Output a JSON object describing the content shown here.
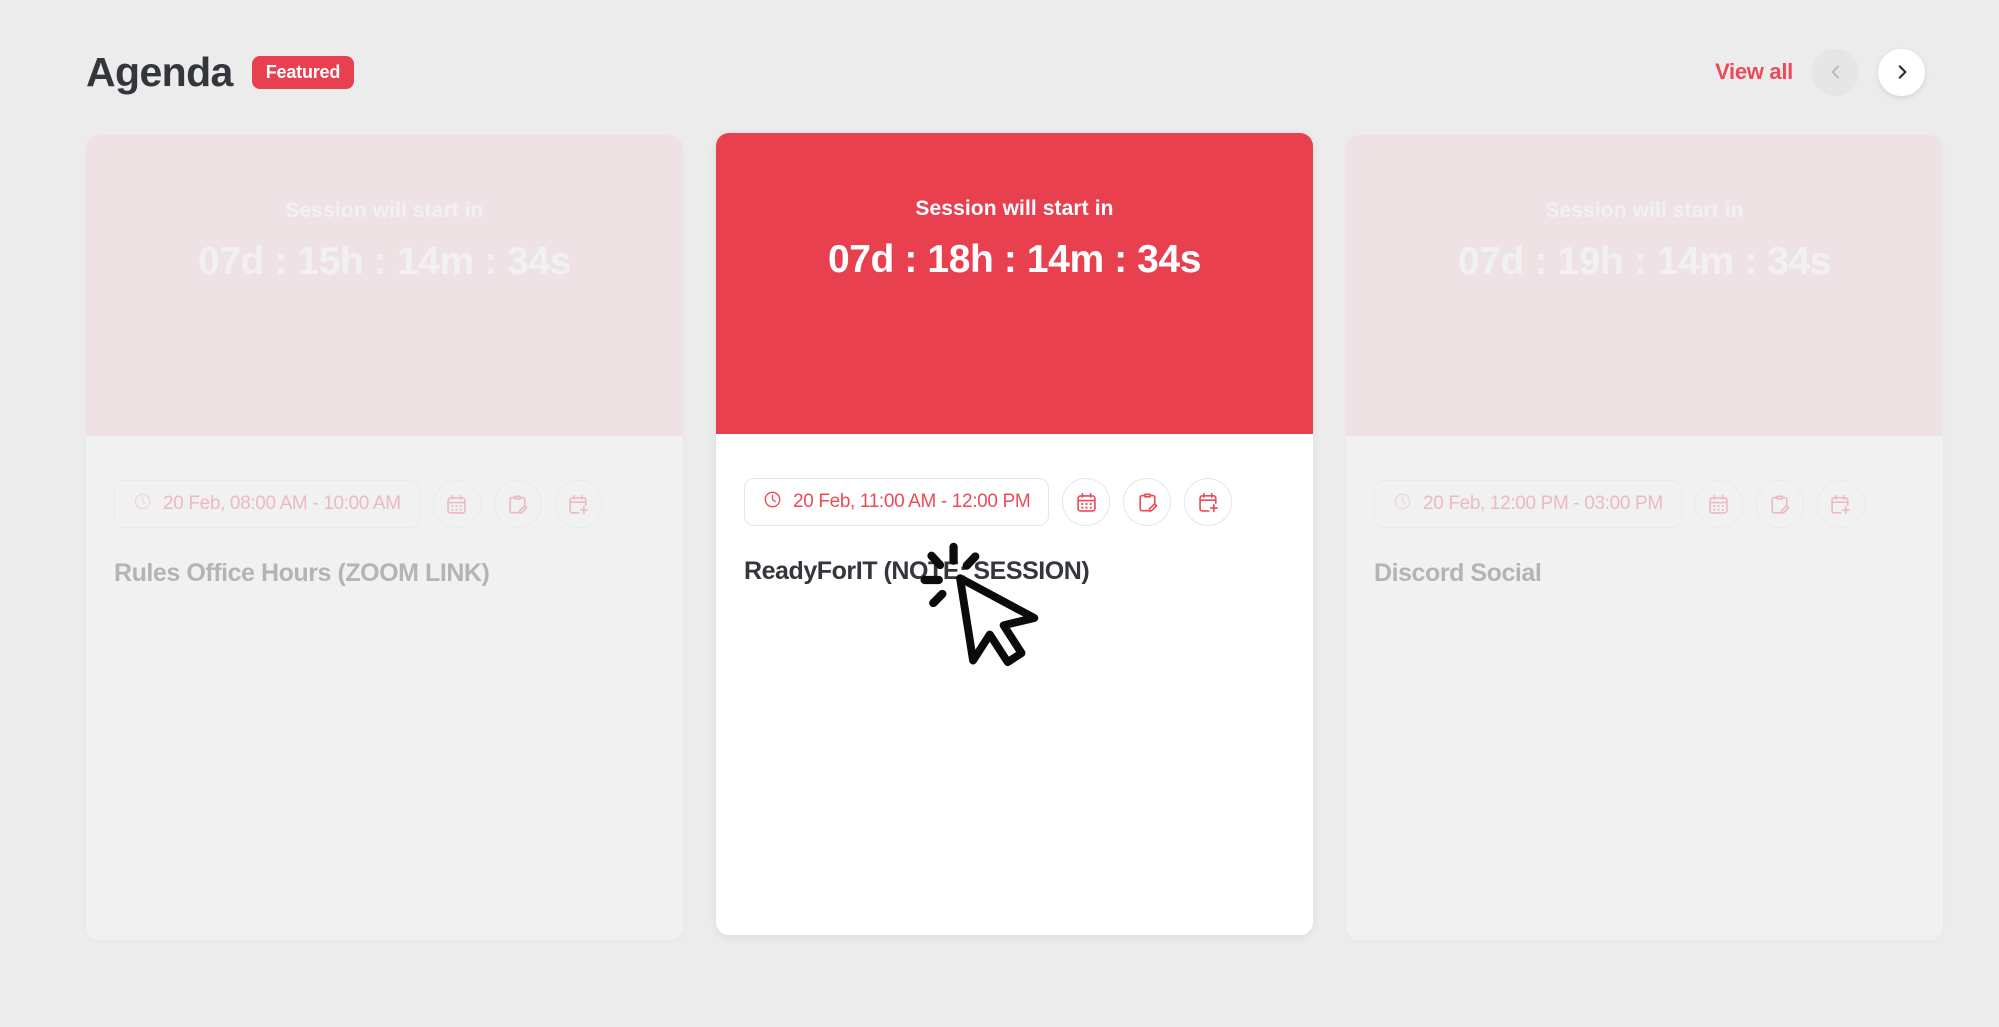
{
  "header": {
    "title": "Agenda",
    "badge": "Featured",
    "view_all_label": "View all",
    "prev_icon": "chevron-left-icon",
    "next_icon": "chevron-right-icon",
    "accent_color": "#e8404f",
    "link_color": "#ec4a57"
  },
  "cards": [
    {
      "state": "dimmed",
      "banner_label": "Session will start in",
      "countdown": "07d : 15h : 14m : 34s",
      "banner_color": "#f7ced2",
      "time_label": "20 Feb, 08:00 AM - 10:00 AM",
      "clock_icon": "clock-icon",
      "title": "Rules Office Hours (ZOOM LINK)",
      "actions": [
        {
          "icon": "calendar-icon",
          "name": "view-calendar-button"
        },
        {
          "icon": "clipboard-edit-icon",
          "name": "edit-notes-button"
        },
        {
          "icon": "calendar-add-icon",
          "name": "add-to-calendar-button"
        }
      ]
    },
    {
      "state": "active",
      "banner_label": "Session will start in",
      "countdown": "07d : 18h : 14m : 34s",
      "banner_color": "#e8404f",
      "time_label": "20 Feb, 11:00 AM - 12:00 PM",
      "clock_icon": "clock-icon",
      "title": "ReadyForIT (NOTE: SESSION)",
      "actions": [
        {
          "icon": "calendar-icon",
          "name": "view-calendar-button"
        },
        {
          "icon": "clipboard-edit-icon",
          "name": "edit-notes-button"
        },
        {
          "icon": "calendar-add-icon",
          "name": "add-to-calendar-button"
        }
      ],
      "cursor_icon": "click-cursor-icon"
    },
    {
      "state": "dimmed",
      "banner_label": "Session will start in",
      "countdown": "07d : 19h : 14m : 34s",
      "banner_color": "#f7ced2",
      "time_label": "20 Feb, 12:00 PM - 03:00 PM",
      "clock_icon": "clock-icon",
      "title": "Discord Social",
      "actions": [
        {
          "icon": "calendar-icon",
          "name": "view-calendar-button"
        },
        {
          "icon": "clipboard-edit-icon",
          "name": "edit-notes-button"
        },
        {
          "icon": "calendar-add-icon",
          "name": "add-to-calendar-button"
        }
      ]
    }
  ]
}
